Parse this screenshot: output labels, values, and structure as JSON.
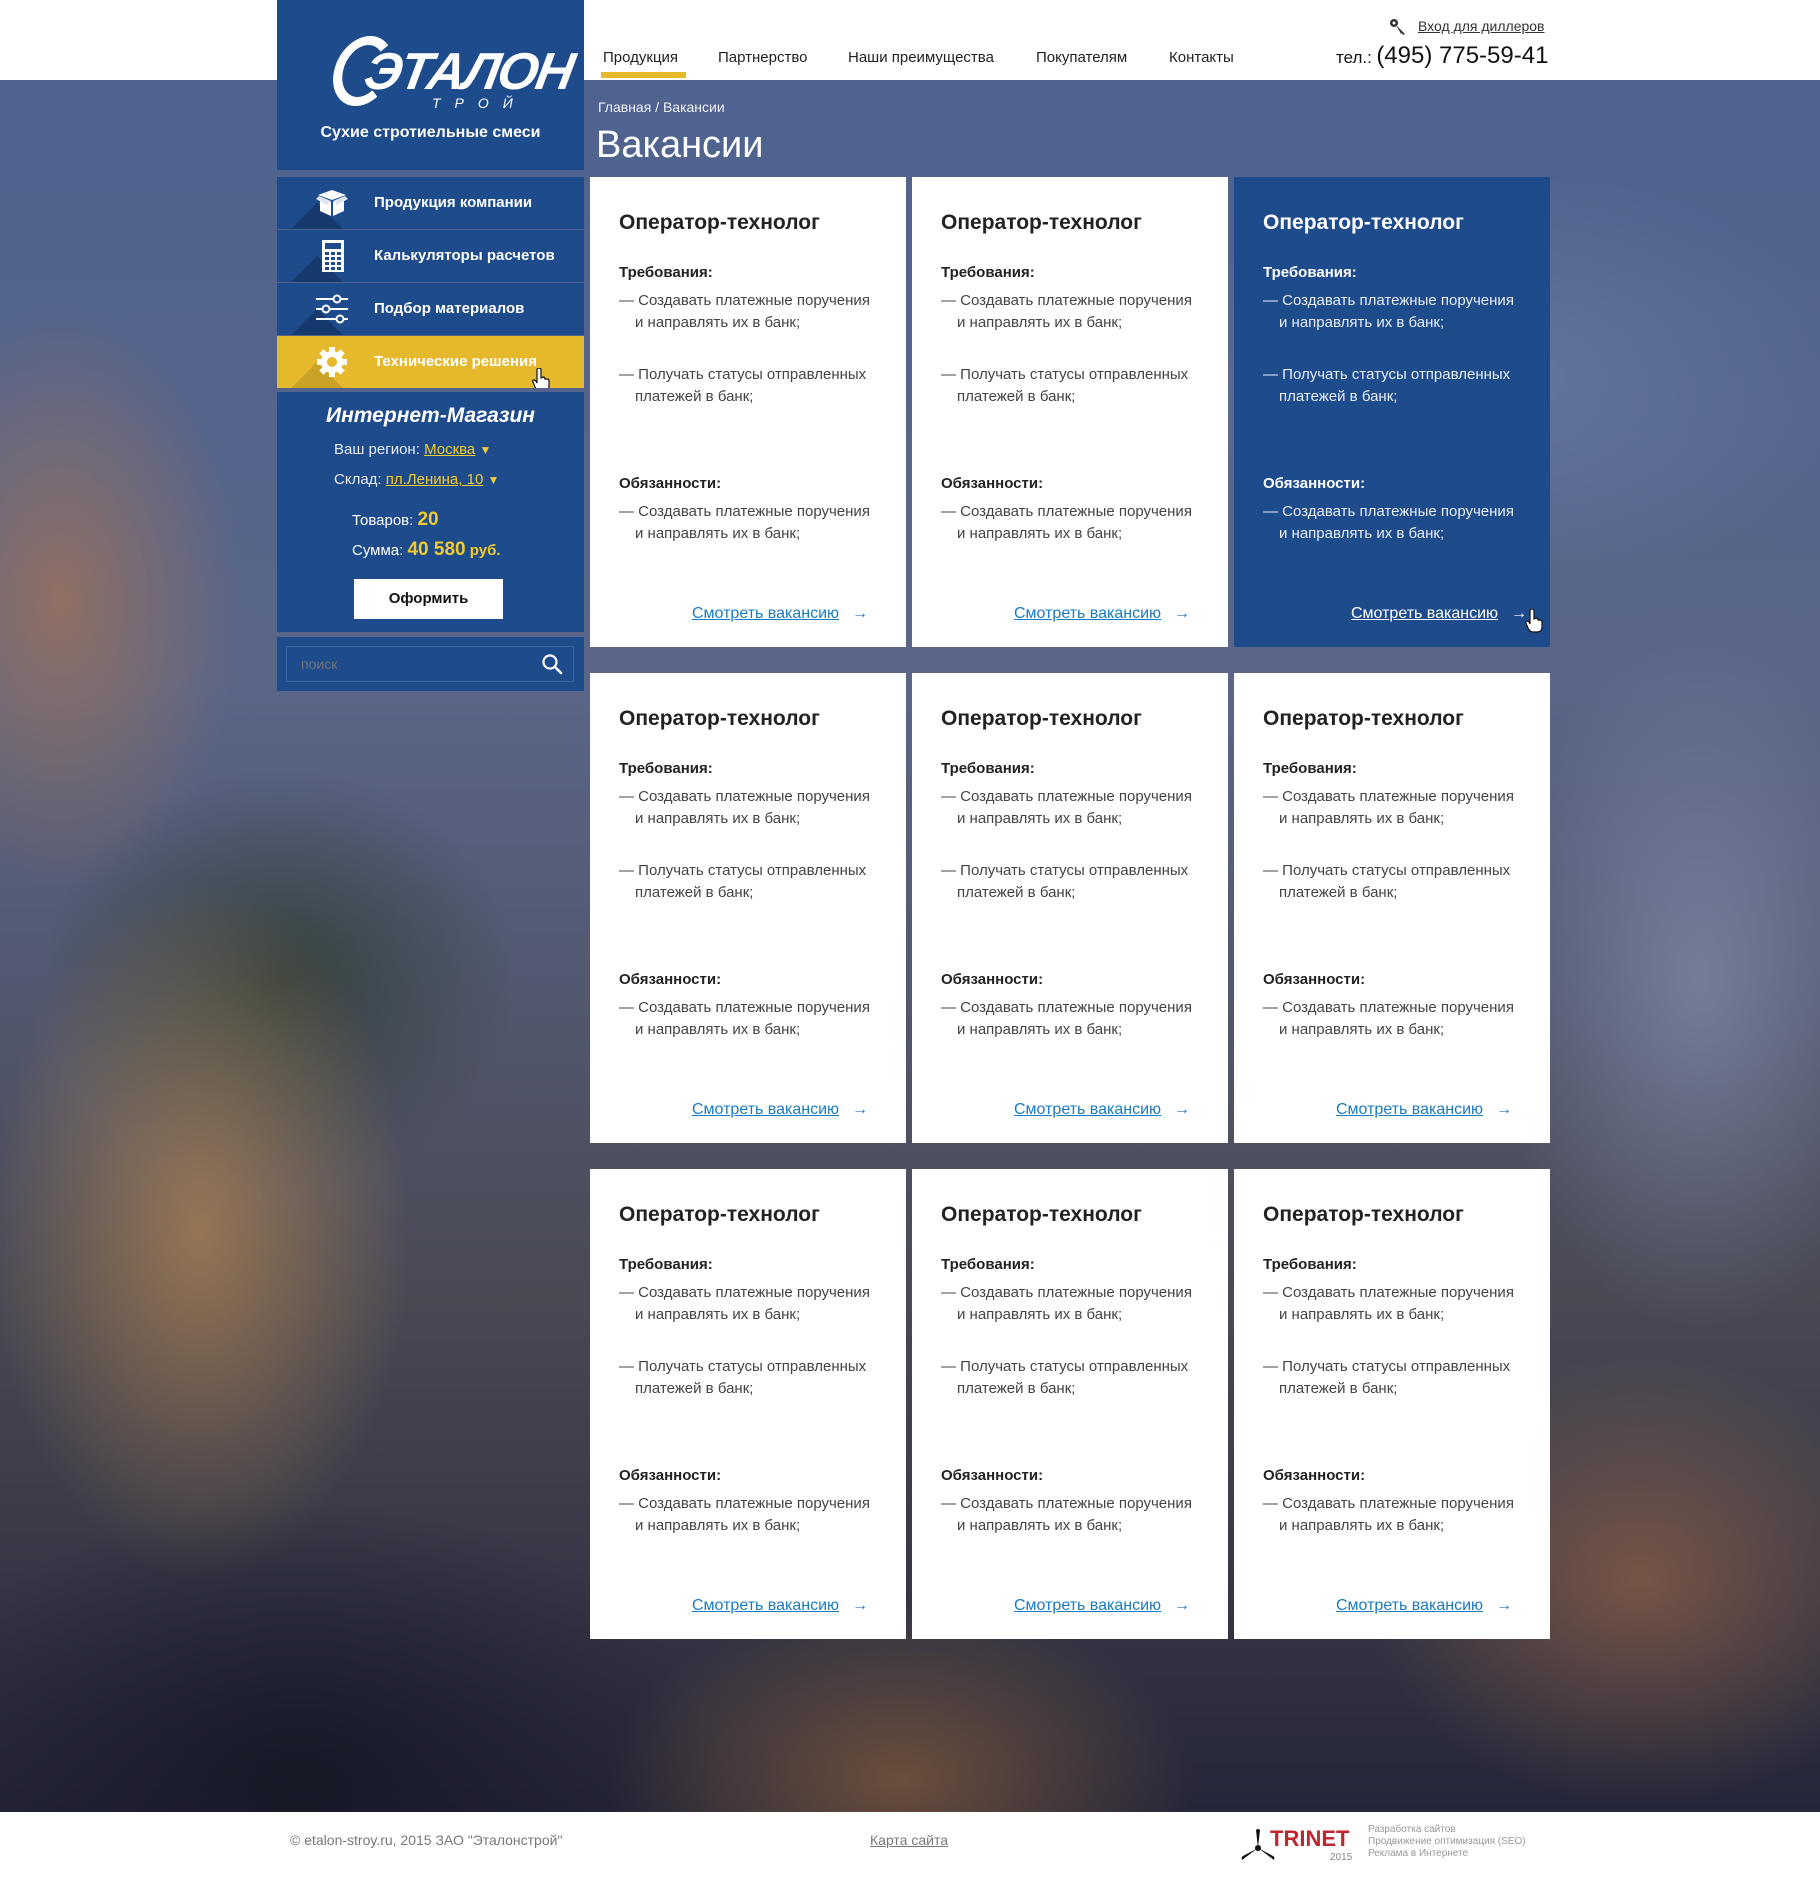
{
  "header": {
    "nav": [
      "Продукция",
      "Партнерство",
      "Наши преимущества",
      "Покупателям",
      "Контакты"
    ],
    "dealer_login": "Вход для диллеров",
    "phone_label": "тел.:",
    "phone_number": "(495) 775-59-41"
  },
  "logo": {
    "word": "ЭТАЛОН",
    "sub": "ТРОЙ",
    "tagline": "Сухие стротиельные смеси"
  },
  "sidebar": {
    "items": [
      {
        "label": "Продукция компании",
        "icon": "box-icon"
      },
      {
        "label": "Калькуляторы расчетов",
        "icon": "calculator-icon"
      },
      {
        "label": "Подбор материалов",
        "icon": "sliders-icon"
      },
      {
        "label": "Технические решения",
        "icon": "gear-icon",
        "active": true
      }
    ]
  },
  "shop": {
    "title": "Интернет-Магазин",
    "region_label": "Ваш регион:",
    "region_value": "Москва",
    "warehouse_label": "Склад:",
    "warehouse_value": "пл.Ленина, 10",
    "dropdown_arrow": "▼",
    "items_label": "Товаров:",
    "items_count": "20",
    "sum_label": "Сумма:",
    "sum_value": "40 580",
    "currency": "руб.",
    "checkout": "Оформить"
  },
  "search": {
    "placeholder": "поиск"
  },
  "breadcrumb": "Главная / Вакансии",
  "page_title": "Вакансии",
  "vacancy": {
    "title": "Оператор-технолог",
    "requirements_label": "Требования:",
    "requirements": [
      "— Создавать платежные поручения и направлять их в банк;",
      "— Получать статусы отправленных платежей в банк;"
    ],
    "duties_label": "Обязанности:",
    "duties": [
      "— Создавать платежные поручения и направлять их в банк;"
    ],
    "link": "Смотреть вакансию",
    "arrow": "→"
  },
  "vacancies_count": 9,
  "highlighted_card": 3,
  "footer": {
    "copyright": "© etalon-stroy.ru, 2015 ЗАО \"Эталонстрой\"",
    "sitemap": "Карта сайта",
    "trinet_name": "TRINET",
    "trinet_year": "2015",
    "trinet_services": [
      "Разработка сайтов",
      "Продвижение оптимизация (SEO)",
      "Реклама в Интернете"
    ]
  },
  "colors": {
    "brand_blue": "#1d4b8c",
    "accent_yellow": "#e6b92d",
    "link_blue": "#1a7bbf",
    "trinet_red": "#c0262d"
  }
}
